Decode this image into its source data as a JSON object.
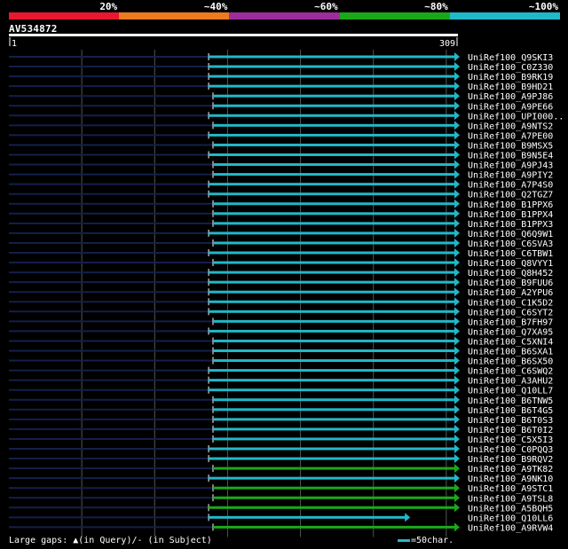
{
  "query": {
    "id": "AV534872",
    "start_label": "1",
    "end_label": "309",
    "length": 309
  },
  "identity_legend": [
    {
      "label": "20%",
      "color": "#e8192f"
    },
    {
      "label": "~40%",
      "color": "#ec7a1e"
    },
    {
      "label": "~60%",
      "color": "#9c2e9c"
    },
    {
      "label": "~80%",
      "color": "#1aa81a"
    },
    {
      "label": "~100%",
      "color": "#21b8c8"
    }
  ],
  "colors": {
    "stub": "#13204a",
    "grid": "#555555",
    "cyan": "#21b8c8",
    "green": "#1aa81a"
  },
  "hits": [
    {
      "name": "UniRef100_Q9SKI3",
      "q_start": 138,
      "q_end": 309,
      "class": "cyan"
    },
    {
      "name": "UniRef100_C0Z330",
      "q_start": 138,
      "q_end": 309,
      "class": "cyan"
    },
    {
      "name": "UniRef100_B9RK19",
      "q_start": 138,
      "q_end": 309,
      "class": "cyan"
    },
    {
      "name": "UniRef100_B9HD21",
      "q_start": 138,
      "q_end": 309,
      "class": "cyan"
    },
    {
      "name": "UniRef100_A9PJ86",
      "q_start": 141,
      "q_end": 309,
      "class": "cyan"
    },
    {
      "name": "UniRef100_A9PE66",
      "q_start": 141,
      "q_end": 309,
      "class": "cyan"
    },
    {
      "name": "UniRef100_UPI000..",
      "q_start": 138,
      "q_end": 309,
      "class": "cyan"
    },
    {
      "name": "UniRef100_A9NTS2",
      "q_start": 141,
      "q_end": 309,
      "class": "cyan"
    },
    {
      "name": "UniRef100_A7PE00",
      "q_start": 138,
      "q_end": 309,
      "class": "cyan"
    },
    {
      "name": "UniRef100_B9MSX5",
      "q_start": 141,
      "q_end": 309,
      "class": "cyan"
    },
    {
      "name": "UniRef100_B9N5E4",
      "q_start": 138,
      "q_end": 309,
      "class": "cyan"
    },
    {
      "name": "UniRef100_A9PJ43",
      "q_start": 141,
      "q_end": 309,
      "class": "cyan"
    },
    {
      "name": "UniRef100_A9PIY2",
      "q_start": 141,
      "q_end": 309,
      "class": "cyan"
    },
    {
      "name": "UniRef100_A7P4S0",
      "q_start": 138,
      "q_end": 309,
      "class": "cyan"
    },
    {
      "name": "UniRef100_Q2TGZ7",
      "q_start": 138,
      "q_end": 309,
      "class": "cyan"
    },
    {
      "name": "UniRef100_B1PPX6",
      "q_start": 141,
      "q_end": 309,
      "class": "cyan"
    },
    {
      "name": "UniRef100_B1PPX4",
      "q_start": 141,
      "q_end": 309,
      "class": "cyan"
    },
    {
      "name": "UniRef100_B1PPX3",
      "q_start": 141,
      "q_end": 309,
      "class": "cyan"
    },
    {
      "name": "UniRef100_Q6Q9W1",
      "q_start": 138,
      "q_end": 309,
      "class": "cyan"
    },
    {
      "name": "UniRef100_C6SVA3",
      "q_start": 141,
      "q_end": 309,
      "class": "cyan"
    },
    {
      "name": "UniRef100_C6TBW1",
      "q_start": 138,
      "q_end": 309,
      "class": "cyan"
    },
    {
      "name": "UniRef100_Q8VYY1",
      "q_start": 141,
      "q_end": 309,
      "class": "cyan"
    },
    {
      "name": "UniRef100_Q8H452",
      "q_start": 138,
      "q_end": 309,
      "class": "cyan"
    },
    {
      "name": "UniRef100_B9FUU6",
      "q_start": 138,
      "q_end": 309,
      "class": "cyan"
    },
    {
      "name": "UniRef100_A2YPU6",
      "q_start": 138,
      "q_end": 309,
      "class": "cyan"
    },
    {
      "name": "UniRef100_C1K5D2",
      "q_start": 138,
      "q_end": 309,
      "class": "cyan"
    },
    {
      "name": "UniRef100_C6SYT2",
      "q_start": 138,
      "q_end": 309,
      "class": "cyan"
    },
    {
      "name": "UniRef100_B7FH97",
      "q_start": 141,
      "q_end": 309,
      "class": "cyan"
    },
    {
      "name": "UniRef100_Q7XA95",
      "q_start": 138,
      "q_end": 309,
      "class": "cyan"
    },
    {
      "name": "UniRef100_C5XNI4",
      "q_start": 141,
      "q_end": 309,
      "class": "cyan"
    },
    {
      "name": "UniRef100_B6SXA1",
      "q_start": 141,
      "q_end": 309,
      "class": "cyan"
    },
    {
      "name": "UniRef100_B6SX50",
      "q_start": 141,
      "q_end": 309,
      "class": "cyan"
    },
    {
      "name": "UniRef100_C6SWQ2",
      "q_start": 138,
      "q_end": 309,
      "class": "cyan"
    },
    {
      "name": "UniRef100_A3AHU2",
      "q_start": 138,
      "q_end": 309,
      "class": "cyan"
    },
    {
      "name": "UniRef100_Q10LL7",
      "q_start": 138,
      "q_end": 309,
      "class": "cyan"
    },
    {
      "name": "UniRef100_B6TNW5",
      "q_start": 141,
      "q_end": 309,
      "class": "cyan"
    },
    {
      "name": "UniRef100_B6T4G5",
      "q_start": 141,
      "q_end": 309,
      "class": "cyan"
    },
    {
      "name": "UniRef100_B6T0S3",
      "q_start": 141,
      "q_end": 309,
      "class": "cyan"
    },
    {
      "name": "UniRef100_B6T0I2",
      "q_start": 141,
      "q_end": 309,
      "class": "cyan"
    },
    {
      "name": "UniRef100_C5X5I3",
      "q_start": 141,
      "q_end": 309,
      "class": "cyan"
    },
    {
      "name": "UniRef100_C0PQQ3",
      "q_start": 138,
      "q_end": 309,
      "class": "cyan"
    },
    {
      "name": "UniRef100_B9RQV2",
      "q_start": 138,
      "q_end": 309,
      "class": "cyan"
    },
    {
      "name": "UniRef100_A9TK82",
      "q_start": 141,
      "q_end": 309,
      "class": "green"
    },
    {
      "name": "UniRef100_A9NK10",
      "q_start": 138,
      "q_end": 309,
      "class": "cyan"
    },
    {
      "name": "UniRef100_A9STC1",
      "q_start": 141,
      "q_end": 309,
      "class": "green"
    },
    {
      "name": "UniRef100_A9TSL8",
      "q_start": 141,
      "q_end": 309,
      "class": "green"
    },
    {
      "name": "UniRef100_A5BQH5",
      "q_start": 138,
      "q_end": 309,
      "class": "green"
    },
    {
      "name": "UniRef100_Q10LL6",
      "q_start": 138,
      "q_end": 275,
      "class": "cyan"
    },
    {
      "name": "UniRef100_A9RVW4",
      "q_start": 141,
      "q_end": 309,
      "class": "green"
    }
  ],
  "footer": {
    "gaps_text": "Large gaps: ▲(in Query)/- (in Subject)",
    "scale_text": "=50char."
  }
}
